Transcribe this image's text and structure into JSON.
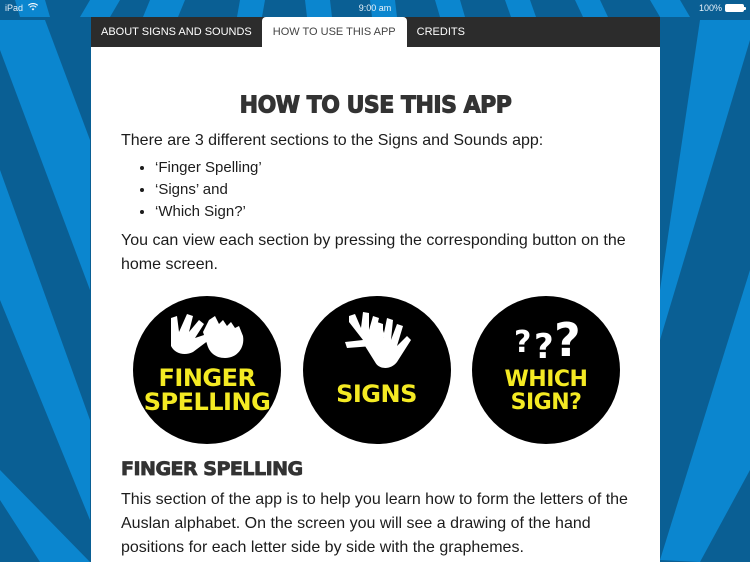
{
  "status_bar": {
    "device": "iPad",
    "time": "9:00 am",
    "battery": "100%"
  },
  "tabs": [
    {
      "label": "ABOUT SIGNS AND SOUNDS",
      "active": false
    },
    {
      "label": "HOW TO USE THIS APP",
      "active": true
    },
    {
      "label": "CREDITS",
      "active": false
    }
  ],
  "content": {
    "title": "HOW TO USE THIS APP",
    "intro": "There are 3 different sections to the Signs and Sounds app:",
    "sections_list": [
      "‘Finger Spelling’",
      "‘Signs’ and",
      "‘Which Sign?’"
    ],
    "instruction": "You can view each section by pressing the corresponding button on the home screen.",
    "buttons": [
      {
        "line1": "FINGER",
        "line2": "SPELLING",
        "icon": "finger-spelling-hands-icon"
      },
      {
        "line1": "SIGNS",
        "line2": "",
        "icon": "waving-hands-icon"
      },
      {
        "line1": "WHICH",
        "line2": "SIGN?",
        "icon": "question-marks-icon"
      }
    ],
    "finger_spelling": {
      "heading": "FINGER SPELLING",
      "body": "This section of the app is to help you learn how to form the letters of the Auslan alphabet. On the screen you will see a drawing of the hand positions for each letter side by side with the graphemes."
    }
  },
  "colors": {
    "stripe_dark": "#0a5f94",
    "stripe_light": "#0b86cf",
    "tabbar": "#2c2c2c",
    "button_label": "#f4ea23"
  }
}
